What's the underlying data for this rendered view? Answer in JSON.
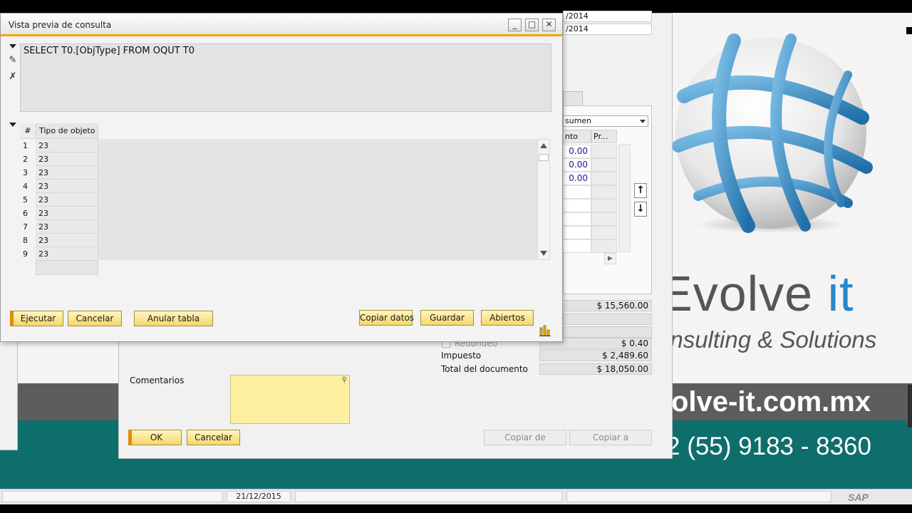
{
  "colors": {
    "accent_orange": "#f0a800",
    "button_yellow": "#f6d66a",
    "brand_blue": "#2a87c8",
    "brand_teal": "#0e6e6c",
    "comments_yellow": "#fdf0a0"
  },
  "branding": {
    "name_main": "Evolve ",
    "name_accent": "it",
    "tagline": "onsulting & Solutions",
    "url": "olve-it.com.mx",
    "phone": "2 (55) 9183 - 8360"
  },
  "status_bar": {
    "date": "21/12/2015",
    "app_brand": "SAP"
  },
  "main_window": {
    "date_field_1": "/2014",
    "date_field_2": "/2014",
    "summary_combo": "sumen",
    "columns": [
      "nto",
      "Pr..."
    ],
    "amount_cells": [
      "0.00",
      "0.00",
      "0.00"
    ],
    "totals": {
      "before_discount": "$ 15,560.00",
      "rounding_label": "Redondeo",
      "rounding_value": "$ 0.40",
      "tax_label": "Impuesto",
      "tax_value": "$ 2,489.60",
      "total_label": "Total del documento",
      "total_value": "$ 18,050.00"
    },
    "comments_label": "Comentarios",
    "buttons": {
      "ok": "OK",
      "cancel": "Cancelar",
      "copy_from": "Copiar de",
      "copy_to": "Copiar a"
    }
  },
  "dialog": {
    "title": "Vista previa de consulta",
    "window_controls": {
      "minimize": "_",
      "maximize": "□",
      "close": "✕"
    },
    "sql_text": "SELECT T0.[ObjType] FROM OQUT T0",
    "grid": {
      "headers": [
        "#",
        "Tipo de objeto"
      ],
      "rows": [
        {
          "num": "1",
          "value": "23"
        },
        {
          "num": "2",
          "value": "23"
        },
        {
          "num": "3",
          "value": "23"
        },
        {
          "num": "4",
          "value": "23"
        },
        {
          "num": "5",
          "value": "23"
        },
        {
          "num": "6",
          "value": "23"
        },
        {
          "num": "7",
          "value": "23"
        },
        {
          "num": "8",
          "value": "23"
        },
        {
          "num": "9",
          "value": "23"
        }
      ]
    },
    "buttons": {
      "execute": "Ejecutar",
      "cancel": "Cancelar",
      "cancel_table": "Anular tabla",
      "copy_data": "Copiar datos",
      "save": "Guardar",
      "open": "Abiertos"
    }
  }
}
